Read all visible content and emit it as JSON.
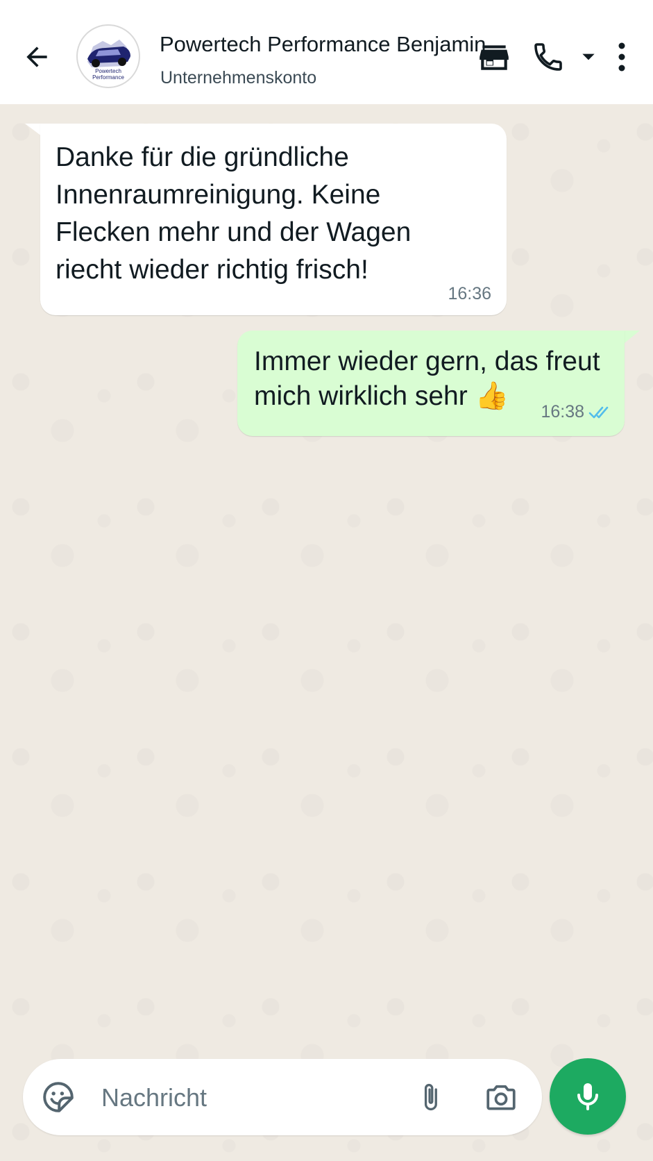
{
  "header": {
    "contact_name": "Powertech Performance Benjamin",
    "subtitle": "Unternehmenskonto",
    "avatar_text_line1": "Powertech",
    "avatar_text_line2": "Performance",
    "icons": [
      "back-arrow-icon",
      "store-icon",
      "phone-icon",
      "chevron-down-icon",
      "more-vert-icon"
    ]
  },
  "messages": [
    {
      "direction": "incoming",
      "lines": [
        "Danke für die gründliche",
        "Innenraumreinigung. Keine",
        "Flecken mehr und der Wagen",
        "riecht wieder richtig frisch!"
      ],
      "time": "16:36"
    },
    {
      "direction": "outgoing",
      "lines": [
        "Immer wieder gern, das freut",
        "mich wirklich sehr"
      ],
      "emoji": "👍",
      "time": "16:38",
      "status": "read"
    }
  ],
  "input": {
    "placeholder": "Nachricht",
    "icons": [
      "sticker-icon",
      "attach-icon",
      "camera-icon",
      "mic-icon"
    ]
  },
  "colors": {
    "outgoing_bubble": "#d9fdd3",
    "incoming_bubble": "#ffffff",
    "chat_background": "#efeae2",
    "mic_button": "#1daa61",
    "read_ticks": "#53bdeb"
  }
}
